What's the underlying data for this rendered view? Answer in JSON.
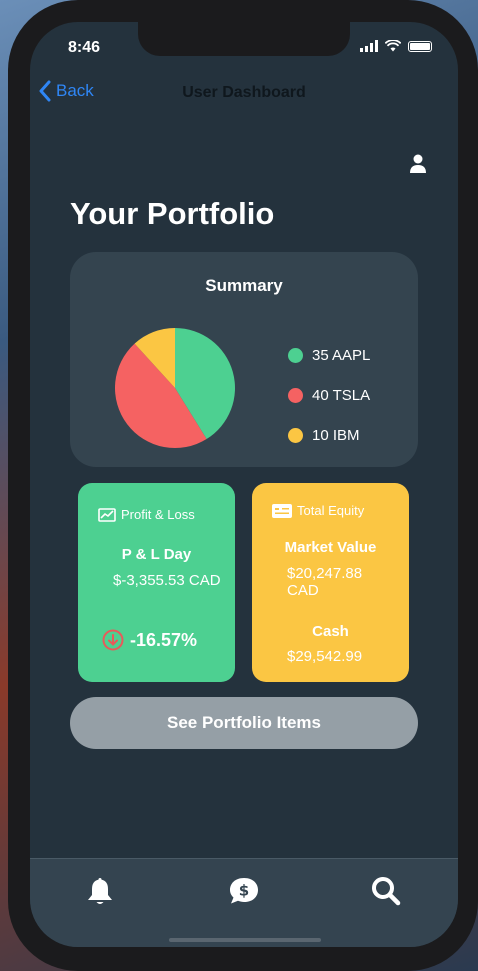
{
  "status": {
    "time": "8:46"
  },
  "nav": {
    "back_label": "Back",
    "title": "User Dashboard"
  },
  "page": {
    "heading": "Your Portfolio"
  },
  "summary": {
    "title": "Summary",
    "legend": [
      {
        "label": "35 AAPL",
        "color": "#4dd091"
      },
      {
        "label": "40 TSLA",
        "color": "#f56262"
      },
      {
        "label": "10 IBM",
        "color": "#fbc643"
      }
    ]
  },
  "chart_data": {
    "type": "pie",
    "categories": [
      "AAPL",
      "TSLA",
      "IBM"
    ],
    "values": [
      35,
      40,
      10
    ],
    "colors": [
      "#4dd091",
      "#f56262",
      "#fbc643"
    ]
  },
  "profit_loss": {
    "title": "Profit & Loss",
    "day_label": "P & L Day",
    "day_value": "$-3,355.53 CAD",
    "percent": "-16.57%"
  },
  "equity": {
    "title": "Total Equity",
    "market_value_label": "Market Value",
    "market_value": "$20,247.88 CAD",
    "cash_label": "Cash",
    "cash_value": "$29,542.99"
  },
  "actions": {
    "see_items_label": "See Portfolio Items"
  },
  "tabbar": {
    "items": [
      "bell-icon",
      "dollar-chat-icon",
      "search-icon"
    ]
  }
}
